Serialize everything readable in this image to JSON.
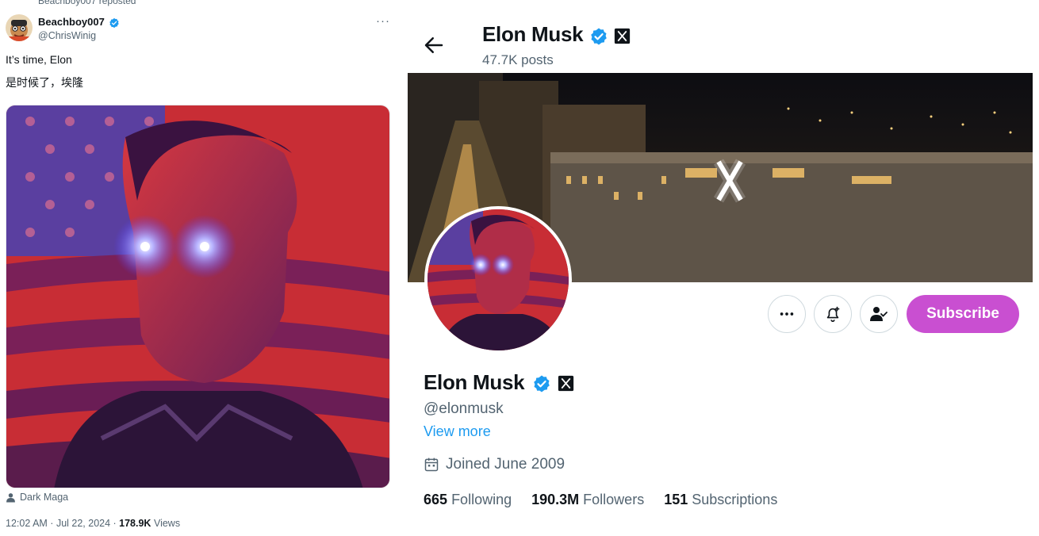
{
  "tweet": {
    "repost_text": "Beachboy007 reposted",
    "author_name": "Beachboy007",
    "author_handle": "@ChrisWinig",
    "more_icon": "ellipsis-icon",
    "text_line1": "It’s time, Elon",
    "text_line2": "是时候了，埃隆",
    "media_credit": "Dark Maga",
    "time": "12:02 AM",
    "date": "Jul 22, 2024",
    "views_count": "178.9K",
    "views_label": "Views"
  },
  "profile": {
    "header_name": "Elon Musk",
    "posts_count": "47.7K posts",
    "name": "Elon Musk",
    "handle": "@elonmusk",
    "view_more": "View more",
    "joined": "Joined June 2009",
    "stats": {
      "following_count": "665",
      "following_label": "Following",
      "followers_count": "190.3M",
      "followers_label": "Followers",
      "subscriptions_count": "151",
      "subscriptions_label": "Subscriptions"
    },
    "actions": {
      "subscribe_label": "Subscribe"
    }
  },
  "colors": {
    "verified_blue": "#1d9bf0",
    "subscribe_purple": "#c94fd1",
    "secondary_text": "#536471",
    "link_blue": "#1d9bf0"
  }
}
